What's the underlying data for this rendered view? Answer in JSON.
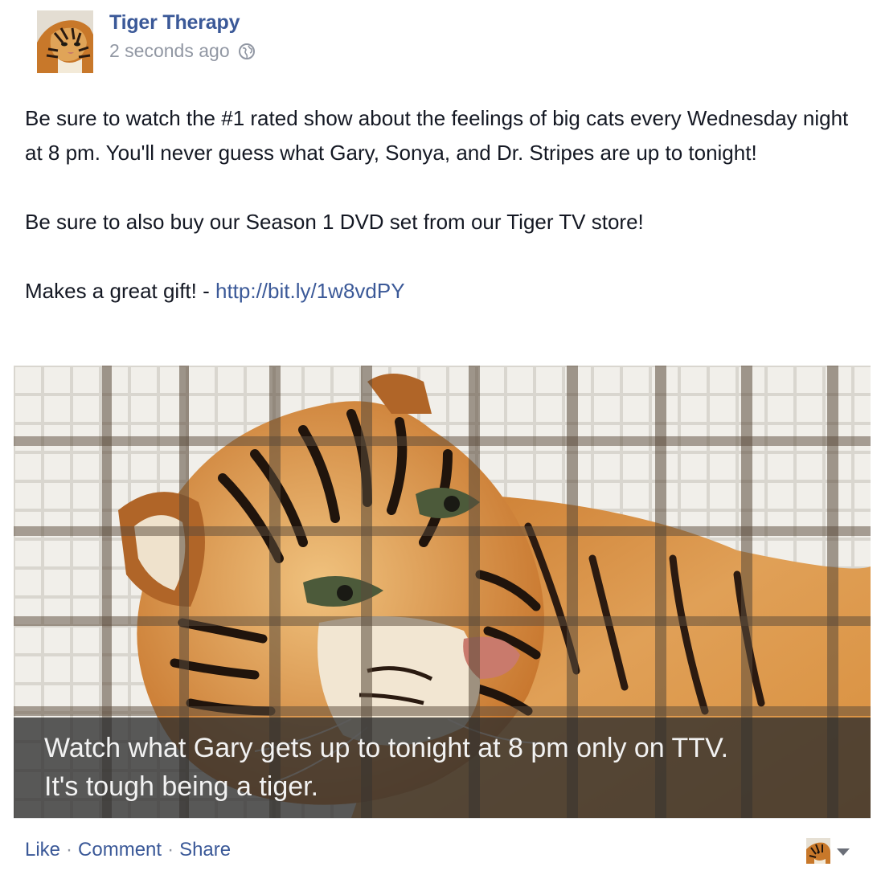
{
  "post": {
    "page_name": "Tiger Therapy",
    "timestamp": "2 seconds ago",
    "privacy_icon": "globe-icon",
    "paragraphs": [
      "Be sure to watch the #1 rated show about the feelings of big cats every Wednesday night at 8 pm. You'll never guess what Gary, Sonya, and Dr. Stripes are up to tonight!",
      "Be sure to also buy our Season 1 DVD set from our Tiger TV store!",
      "Makes a great gift! - "
    ],
    "link_text": "http://bit.ly/1w8vdPY",
    "photo": {
      "caption_line1": "Watch what Gary gets up to tonight at 8 pm only on TTV.",
      "caption_line2": "It's tough being a tiger."
    }
  },
  "actions": {
    "like": "Like",
    "comment": "Comment",
    "share": "Share",
    "separator": "·"
  },
  "colors": {
    "link": "#3b5998",
    "meta": "#9197a3",
    "text": "#141823"
  }
}
